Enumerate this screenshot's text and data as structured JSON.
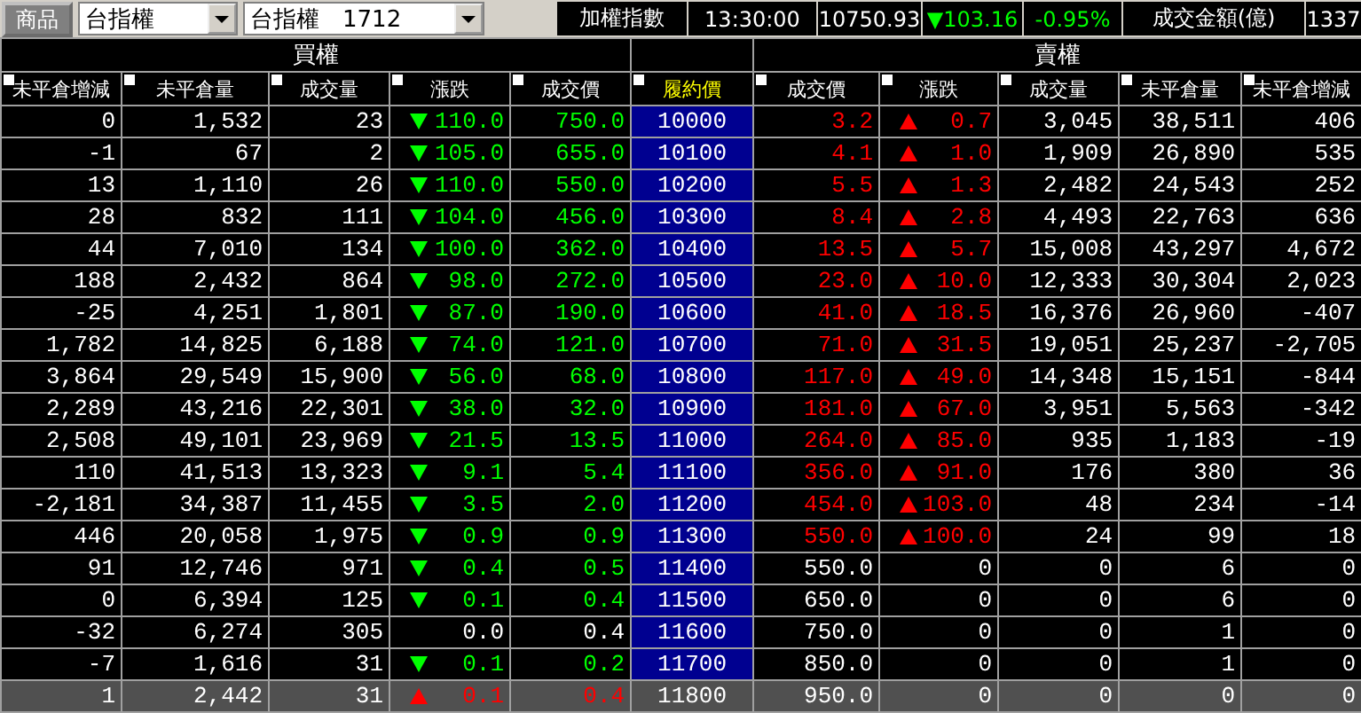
{
  "toolbar": {
    "product_button": "商品",
    "product_select": "台指權",
    "contract_select": "台指權　1712"
  },
  "index": {
    "name": "加權指數",
    "time": "13:30:00",
    "value": "10750.93",
    "change": "▼103.16",
    "change_pct": "-0.95%",
    "turnover_label": "成交金額(億)",
    "turnover": "1337"
  },
  "sections": {
    "call": "買權",
    "put": "賣權"
  },
  "columns": [
    {
      "label": "未平倉增減",
      "kind": "normal"
    },
    {
      "label": "未平倉量",
      "kind": "normal"
    },
    {
      "label": "成交量",
      "kind": "normal"
    },
    {
      "label": "漲跌",
      "kind": "normal"
    },
    {
      "label": "成交價",
      "kind": "normal"
    },
    {
      "label": "履約價",
      "kind": "strike"
    },
    {
      "label": "成交價",
      "kind": "normal"
    },
    {
      "label": "漲跌",
      "kind": "normal"
    },
    {
      "label": "成交量",
      "kind": "normal"
    },
    {
      "label": "未平倉量",
      "kind": "normal"
    },
    {
      "label": "未平倉增減",
      "kind": "normal"
    }
  ],
  "rows": [
    {
      "selected": false,
      "strike": "10000",
      "call": {
        "oi_change": "0",
        "open_interest": "1,532",
        "volume": "23",
        "change": "110.0",
        "price": "750.0",
        "kind": "down"
      },
      "put": {
        "price": "3.2",
        "change": "0.7",
        "volume": "3,045",
        "open_interest": "38,511",
        "oi_change": "406",
        "kind": "up"
      }
    },
    {
      "selected": false,
      "strike": "10100",
      "call": {
        "oi_change": "-1",
        "open_interest": "67",
        "volume": "2",
        "change": "105.0",
        "price": "655.0",
        "kind": "down"
      },
      "put": {
        "price": "4.1",
        "change": "1.0",
        "volume": "1,909",
        "open_interest": "26,890",
        "oi_change": "535",
        "kind": "up"
      }
    },
    {
      "selected": false,
      "strike": "10200",
      "call": {
        "oi_change": "13",
        "open_interest": "1,110",
        "volume": "26",
        "change": "110.0",
        "price": "550.0",
        "kind": "down"
      },
      "put": {
        "price": "5.5",
        "change": "1.3",
        "volume": "2,482",
        "open_interest": "24,543",
        "oi_change": "252",
        "kind": "up"
      }
    },
    {
      "selected": false,
      "strike": "10300",
      "call": {
        "oi_change": "28",
        "open_interest": "832",
        "volume": "111",
        "change": "104.0",
        "price": "456.0",
        "kind": "down"
      },
      "put": {
        "price": "8.4",
        "change": "2.8",
        "volume": "4,493",
        "open_interest": "22,763",
        "oi_change": "636",
        "kind": "up"
      }
    },
    {
      "selected": false,
      "strike": "10400",
      "call": {
        "oi_change": "44",
        "open_interest": "7,010",
        "volume": "134",
        "change": "100.0",
        "price": "362.0",
        "kind": "down"
      },
      "put": {
        "price": "13.5",
        "change": "5.7",
        "volume": "15,008",
        "open_interest": "43,297",
        "oi_change": "4,672",
        "kind": "up"
      }
    },
    {
      "selected": false,
      "strike": "10500",
      "call": {
        "oi_change": "188",
        "open_interest": "2,432",
        "volume": "864",
        "change": "98.0",
        "price": "272.0",
        "kind": "down"
      },
      "put": {
        "price": "23.0",
        "change": "10.0",
        "volume": "12,333",
        "open_interest": "30,304",
        "oi_change": "2,023",
        "kind": "up"
      }
    },
    {
      "selected": false,
      "strike": "10600",
      "call": {
        "oi_change": "-25",
        "open_interest": "4,251",
        "volume": "1,801",
        "change": "87.0",
        "price": "190.0",
        "kind": "down"
      },
      "put": {
        "price": "41.0",
        "change": "18.5",
        "volume": "16,376",
        "open_interest": "26,960",
        "oi_change": "-407",
        "kind": "up"
      }
    },
    {
      "selected": false,
      "strike": "10700",
      "call": {
        "oi_change": "1,782",
        "open_interest": "14,825",
        "volume": "6,188",
        "change": "74.0",
        "price": "121.0",
        "kind": "down"
      },
      "put": {
        "price": "71.0",
        "change": "31.5",
        "volume": "19,051",
        "open_interest": "25,237",
        "oi_change": "-2,705",
        "kind": "up"
      }
    },
    {
      "selected": false,
      "strike": "10800",
      "call": {
        "oi_change": "3,864",
        "open_interest": "29,549",
        "volume": "15,900",
        "change": "56.0",
        "price": "68.0",
        "kind": "down"
      },
      "put": {
        "price": "117.0",
        "change": "49.0",
        "volume": "14,348",
        "open_interest": "15,151",
        "oi_change": "-844",
        "kind": "up"
      }
    },
    {
      "selected": false,
      "strike": "10900",
      "call": {
        "oi_change": "2,289",
        "open_interest": "43,216",
        "volume": "22,301",
        "change": "38.0",
        "price": "32.0",
        "kind": "down"
      },
      "put": {
        "price": "181.0",
        "change": "67.0",
        "volume": "3,951",
        "open_interest": "5,563",
        "oi_change": "-342",
        "kind": "up"
      }
    },
    {
      "selected": false,
      "strike": "11000",
      "call": {
        "oi_change": "2,508",
        "open_interest": "49,101",
        "volume": "23,969",
        "change": "21.5",
        "price": "13.5",
        "kind": "down"
      },
      "put": {
        "price": "264.0",
        "change": "85.0",
        "volume": "935",
        "open_interest": "1,183",
        "oi_change": "-19",
        "kind": "up"
      }
    },
    {
      "selected": false,
      "strike": "11100",
      "call": {
        "oi_change": "110",
        "open_interest": "41,513",
        "volume": "13,323",
        "change": "9.1",
        "price": "5.4",
        "kind": "down"
      },
      "put": {
        "price": "356.0",
        "change": "91.0",
        "volume": "176",
        "open_interest": "380",
        "oi_change": "36",
        "kind": "up"
      }
    },
    {
      "selected": false,
      "strike": "11200",
      "call": {
        "oi_change": "-2,181",
        "open_interest": "34,387",
        "volume": "11,455",
        "change": "3.5",
        "price": "2.0",
        "kind": "down"
      },
      "put": {
        "price": "454.0",
        "change": "103.0",
        "volume": "48",
        "open_interest": "234",
        "oi_change": "-14",
        "kind": "up"
      }
    },
    {
      "selected": false,
      "strike": "11300",
      "call": {
        "oi_change": "446",
        "open_interest": "20,058",
        "volume": "1,975",
        "change": "0.9",
        "price": "0.9",
        "kind": "down"
      },
      "put": {
        "price": "550.0",
        "change": "100.0",
        "volume": "24",
        "open_interest": "99",
        "oi_change": "18",
        "kind": "up"
      }
    },
    {
      "selected": false,
      "strike": "11400",
      "call": {
        "oi_change": "91",
        "open_interest": "12,746",
        "volume": "971",
        "change": "0.4",
        "price": "0.5",
        "kind": "down"
      },
      "put": {
        "price": "550.0",
        "change": "0",
        "volume": "0",
        "open_interest": "6",
        "oi_change": "0",
        "kind": "flat"
      }
    },
    {
      "selected": false,
      "strike": "11500",
      "call": {
        "oi_change": "0",
        "open_interest": "6,394",
        "volume": "125",
        "change": "0.1",
        "price": "0.4",
        "kind": "down"
      },
      "put": {
        "price": "650.0",
        "change": "0",
        "volume": "0",
        "open_interest": "6",
        "oi_change": "0",
        "kind": "flat"
      }
    },
    {
      "selected": false,
      "strike": "11600",
      "call": {
        "oi_change": "-32",
        "open_interest": "6,274",
        "volume": "305",
        "change": "0.0",
        "price": "0.4",
        "kind": "flat"
      },
      "put": {
        "price": "750.0",
        "change": "0",
        "volume": "0",
        "open_interest": "1",
        "oi_change": "0",
        "kind": "flat"
      }
    },
    {
      "selected": false,
      "strike": "11700",
      "call": {
        "oi_change": "-7",
        "open_interest": "1,616",
        "volume": "31",
        "change": "0.1",
        "price": "0.2",
        "kind": "down"
      },
      "put": {
        "price": "850.0",
        "change": "0",
        "volume": "0",
        "open_interest": "1",
        "oi_change": "0",
        "kind": "flat"
      }
    },
    {
      "selected": true,
      "strike": "11800",
      "call": {
        "oi_change": "1",
        "open_interest": "2,442",
        "volume": "31",
        "change": "0.1",
        "price": "0.4",
        "kind": "up"
      },
      "put": {
        "price": "950.0",
        "change": "0",
        "volume": "0",
        "open_interest": "0",
        "oi_change": "0",
        "kind": "flat"
      }
    }
  ]
}
